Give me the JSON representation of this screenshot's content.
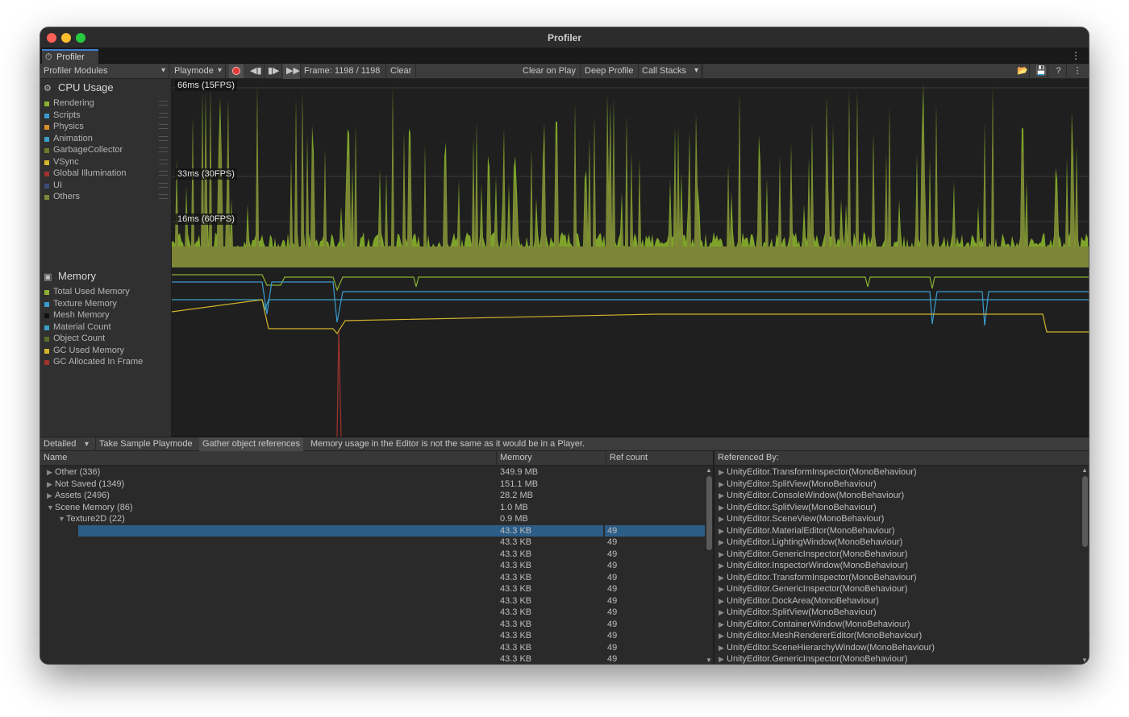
{
  "window": {
    "title": "Profiler"
  },
  "tab": {
    "label": "Profiler",
    "icon": "profiler-icon"
  },
  "toolbar": {
    "modules_dropdown": "Profiler Modules",
    "target_dropdown": "Playmode",
    "frame_label": "Frame: 1198 / 1198",
    "clear": "Clear",
    "clear_on_play": "Clear on Play",
    "deep_profile": "Deep Profile",
    "call_stacks": "Call Stacks"
  },
  "cpu": {
    "title": "CPU Usage",
    "legend": [
      {
        "label": "Rendering",
        "color": "#8bb032"
      },
      {
        "label": "Scripts",
        "color": "#3b9bd0"
      },
      {
        "label": "Physics",
        "color": "#d88e2c"
      },
      {
        "label": "Animation",
        "color": "#3aa0c8"
      },
      {
        "label": "GarbageCollector",
        "color": "#6b7d2a"
      },
      {
        "label": "VSync",
        "color": "#d4b52c"
      },
      {
        "label": "Global Illumination",
        "color": "#a0332c"
      },
      {
        "label": "UI",
        "color": "#3b4a7a"
      },
      {
        "label": "Others",
        "color": "#7c8636"
      }
    ],
    "fps_labels": {
      "l66": "66ms (15FPS)",
      "l33": "33ms (30FPS)",
      "l16": "16ms (60FPS)"
    }
  },
  "memory": {
    "title": "Memory",
    "legend": [
      {
        "label": "Total Used Memory",
        "color": "#8bb032"
      },
      {
        "label": "Texture Memory",
        "color": "#3b9bd0"
      },
      {
        "label": "Mesh Memory",
        "color": "#111111"
      },
      {
        "label": "Material Count",
        "color": "#3aa0c8"
      },
      {
        "label": "Object Count",
        "color": "#5d6e28"
      },
      {
        "label": "GC Used Memory",
        "color": "#d4b52c"
      },
      {
        "label": "GC Allocated In Frame",
        "color": "#a0332c"
      }
    ]
  },
  "detail_bar": {
    "view_dropdown": "Detailed",
    "take_sample": "Take Sample Playmode",
    "gather_refs": "Gather object references",
    "notice": "Memory usage in the Editor is not the same as it would be in a Player."
  },
  "table": {
    "headers": {
      "name": "Name",
      "memory": "Memory",
      "refcount": "Ref count",
      "referenced_by": "Referenced By:"
    },
    "rows": [
      {
        "name": "Other (336)",
        "memory": "349.9 MB",
        "ref": "",
        "indent": 0,
        "tri": "▶"
      },
      {
        "name": "Not Saved (1349)",
        "memory": "151.1 MB",
        "ref": "",
        "indent": 0,
        "tri": "▶"
      },
      {
        "name": "Assets (2496)",
        "memory": "28.2 MB",
        "ref": "",
        "indent": 0,
        "tri": "▶"
      },
      {
        "name": "Scene Memory (86)",
        "memory": "1.0 MB",
        "ref": "",
        "indent": 0,
        "tri": "▼"
      },
      {
        "name": "Texture2D (22)",
        "memory": "0.9 MB",
        "ref": "",
        "indent": 1,
        "tri": "▼"
      },
      {
        "name": "",
        "memory": "43.3 KB",
        "ref": "49",
        "indent": 2,
        "tri": "",
        "selected": true
      },
      {
        "name": "",
        "memory": "43.3 KB",
        "ref": "49",
        "indent": 2,
        "tri": ""
      },
      {
        "name": "",
        "memory": "43.3 KB",
        "ref": "49",
        "indent": 2,
        "tri": ""
      },
      {
        "name": "",
        "memory": "43.3 KB",
        "ref": "49",
        "indent": 2,
        "tri": ""
      },
      {
        "name": "",
        "memory": "43.3 KB",
        "ref": "49",
        "indent": 2,
        "tri": ""
      },
      {
        "name": "",
        "memory": "43.3 KB",
        "ref": "49",
        "indent": 2,
        "tri": ""
      },
      {
        "name": "",
        "memory": "43.3 KB",
        "ref": "49",
        "indent": 2,
        "tri": ""
      },
      {
        "name": "",
        "memory": "43.3 KB",
        "ref": "49",
        "indent": 2,
        "tri": ""
      },
      {
        "name": "",
        "memory": "43.3 KB",
        "ref": "49",
        "indent": 2,
        "tri": ""
      },
      {
        "name": "",
        "memory": "43.3 KB",
        "ref": "49",
        "indent": 2,
        "tri": ""
      },
      {
        "name": "",
        "memory": "43.3 KB",
        "ref": "49",
        "indent": 2,
        "tri": ""
      },
      {
        "name": "",
        "memory": "43.3 KB",
        "ref": "49",
        "indent": 2,
        "tri": ""
      }
    ],
    "referenced_by": [
      "UnityEditor.TransformInspector(MonoBehaviour)",
      "UnityEditor.SplitView(MonoBehaviour)",
      "UnityEditor.ConsoleWindow(MonoBehaviour)",
      "UnityEditor.SplitView(MonoBehaviour)",
      "UnityEditor.SceneView(MonoBehaviour)",
      "UnityEditor.MaterialEditor(MonoBehaviour)",
      "UnityEditor.LightingWindow(MonoBehaviour)",
      "UnityEditor.GenericInspector(MonoBehaviour)",
      "UnityEditor.InspectorWindow(MonoBehaviour)",
      "UnityEditor.TransformInspector(MonoBehaviour)",
      "UnityEditor.GenericInspector(MonoBehaviour)",
      "UnityEditor.DockArea(MonoBehaviour)",
      "UnityEditor.SplitView(MonoBehaviour)",
      "UnityEditor.ContainerWindow(MonoBehaviour)",
      "UnityEditor.MeshRendererEditor(MonoBehaviour)",
      "UnityEditor.SceneHierarchyWindow(MonoBehaviour)",
      "UnityEditor.GenericInspector(MonoBehaviour)"
    ]
  }
}
